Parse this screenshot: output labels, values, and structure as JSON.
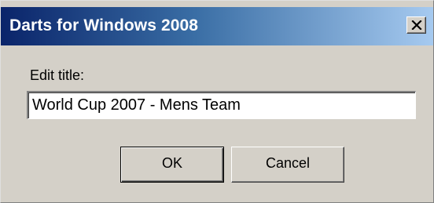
{
  "window": {
    "title": "Darts for Windows 2008",
    "close_icon": "close-icon"
  },
  "form": {
    "label": "Edit title:",
    "title_value": "World Cup 2007 - Mens Team"
  },
  "buttons": {
    "ok_label": "OK",
    "cancel_label": "Cancel"
  },
  "colors": {
    "titlebar_start": "#0a246a",
    "titlebar_end": "#a6caf0",
    "dialog_face": "#d4d0c8"
  }
}
